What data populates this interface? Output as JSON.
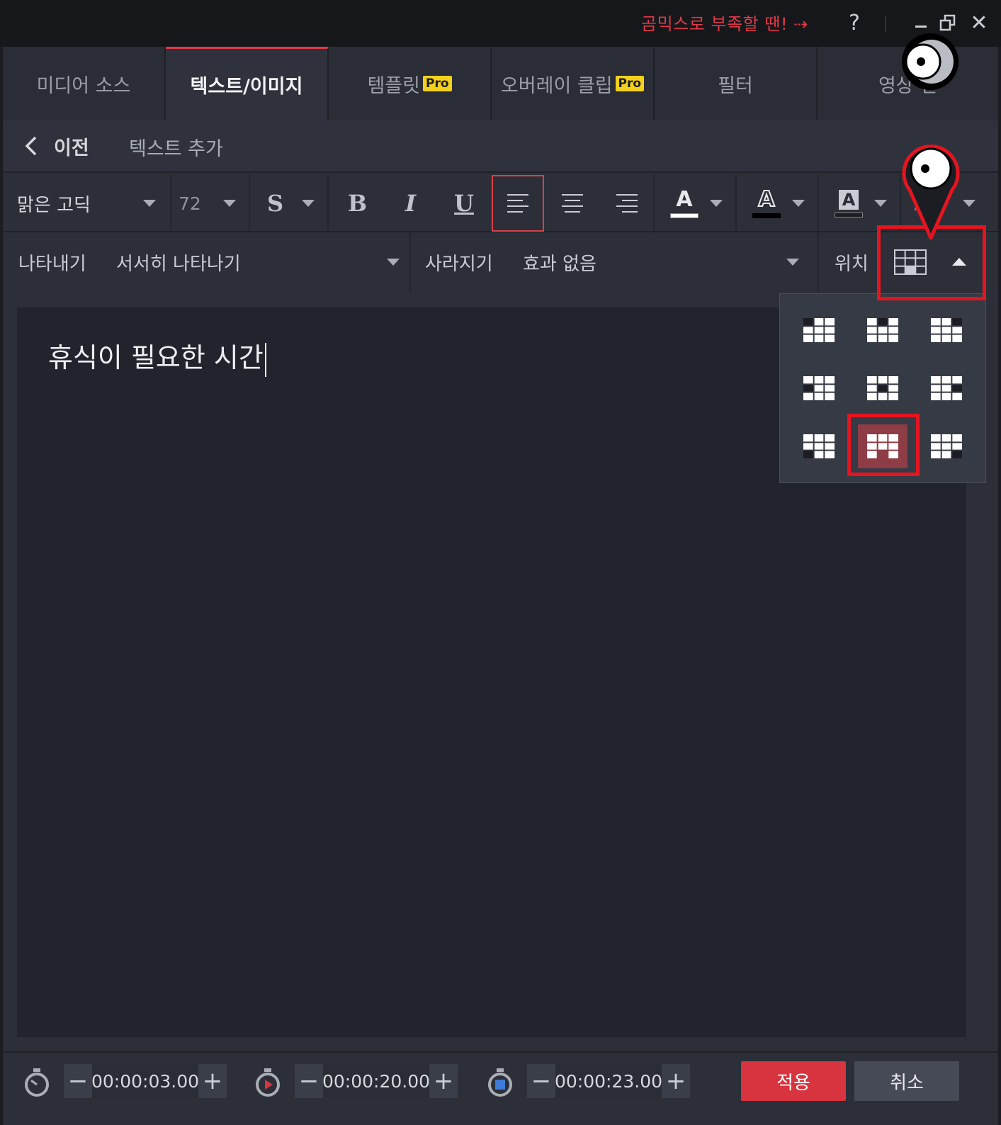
{
  "titlebar": {
    "promo_text": "곰믹스로 부족할 땐! ⇢",
    "help": "?",
    "close": "✕"
  },
  "tabs": [
    {
      "label": "미디어 소스",
      "pro": ""
    },
    {
      "label": "텍스트/이미지",
      "pro": ""
    },
    {
      "label": "템플릿",
      "pro": "Pro"
    },
    {
      "label": "오버레이 클립",
      "pro": "Pro"
    },
    {
      "label": "필터",
      "pro": ""
    },
    {
      "label": "영상 전",
      "pro": ""
    }
  ],
  "subheader": {
    "back_label": "이전",
    "title": "텍스트 추가"
  },
  "toolbar": {
    "font_family": "맑은 고딕",
    "font_size": "72",
    "shadow": "S",
    "bold": "B",
    "italic": "I",
    "underline": "U",
    "font_color_letter": "A",
    "outline_letter": "A",
    "bg_letter": "A",
    "extra_letter": "A",
    "colors": {
      "font_color": "#ffffff",
      "outline_color": "#000000",
      "bg_color": "#1b1d22"
    }
  },
  "effects": {
    "appear_label": "나타내기",
    "appear_value": "서서히 나타나기",
    "disappear_label": "사라지기",
    "disappear_value": "효과 없음",
    "position_label": "위치"
  },
  "canvas": {
    "text": "휴식이 필요한 시간"
  },
  "bottom": {
    "start_time": "00:00:03.00",
    "duration": "00:00:20.00",
    "end_time": "00:00:23.00",
    "minus": "−",
    "plus": "+",
    "apply": "적용",
    "cancel": "취소"
  },
  "colors": {
    "accent": "#e03a45",
    "selected_cell": "#8e3c45",
    "pro_badge": "#f2d01c",
    "highlight": "#e5141f"
  },
  "position_grid": {
    "selected": "bottom-center"
  }
}
